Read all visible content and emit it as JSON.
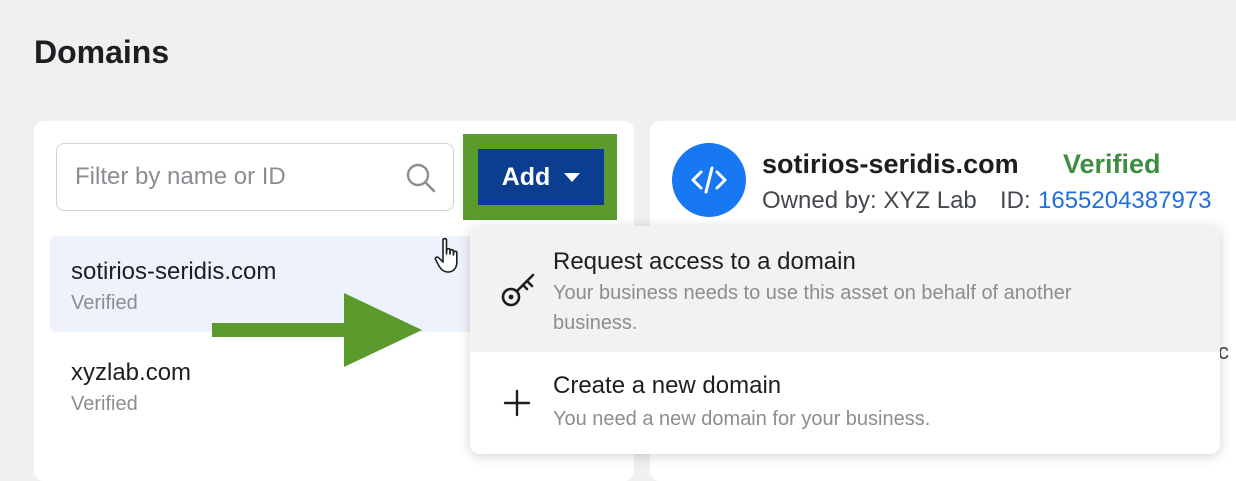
{
  "page": {
    "title": "Domains"
  },
  "search": {
    "placeholder": "Filter by name or ID"
  },
  "toolbar": {
    "add_label": "Add"
  },
  "domains": [
    {
      "name": "sotirios-seridis.com",
      "status": "Verified"
    },
    {
      "name": "xyzlab.com",
      "status": "Verified"
    }
  ],
  "detail": {
    "domain": "sotirios-seridis.com",
    "status": "Verified",
    "owner": "Owned by: XYZ Lab",
    "id_label": "ID:",
    "id_value": "1655204387973",
    "partial_text": "c"
  },
  "dropdown": {
    "items": [
      {
        "title": "Request access to a domain",
        "description": "Your business needs to use this asset on behalf of another business.",
        "icon": "key-icon"
      },
      {
        "title": "Create a new domain",
        "description": "You need a new domain for your business.",
        "icon": "plus-icon"
      }
    ]
  },
  "colors": {
    "primary_button": "#0b3d91",
    "highlight_box": "#5b9a2d",
    "verified": "#3e8e41",
    "link": "#216fdb",
    "badge": "#1877f2"
  }
}
